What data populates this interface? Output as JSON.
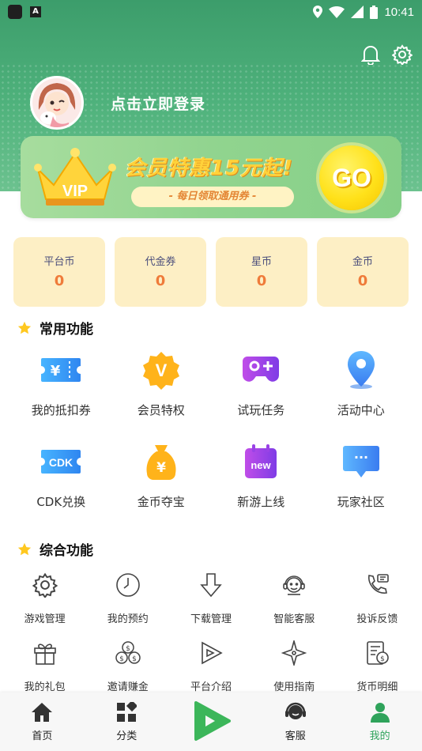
{
  "status_bar": {
    "time": "10:41",
    "app_badge": "A"
  },
  "header": {
    "login_text": "点击立即登录"
  },
  "vip_banner": {
    "vip_text": "VIP",
    "title": "会员特惠15元起!",
    "subtitle": "- 每日领取通用券 -",
    "go_label": "GO"
  },
  "currencies": [
    {
      "label": "平台币",
      "value": "0"
    },
    {
      "label": "代金券",
      "value": "0"
    },
    {
      "label": "星币",
      "value": "0"
    },
    {
      "label": "金币",
      "value": "0"
    }
  ],
  "common": {
    "title": "常用功能",
    "items": [
      {
        "label": "我的抵扣券",
        "icon": "coupon-icon",
        "glyph": "¥"
      },
      {
        "label": "会员特权",
        "icon": "vip-badge-icon",
        "glyph": "V"
      },
      {
        "label": "试玩任务",
        "icon": "gamepad-icon",
        "glyph": ""
      },
      {
        "label": "活动中心",
        "icon": "location-pin-icon",
        "glyph": ""
      },
      {
        "label": "CDK兑换",
        "icon": "cdk-icon",
        "glyph": "CDK"
      },
      {
        "label": "金币夺宝",
        "icon": "money-bag-icon",
        "glyph": "¥"
      },
      {
        "label": "新游上线",
        "icon": "new-calendar-icon",
        "glyph": "new"
      },
      {
        "label": "玩家社区",
        "icon": "chat-bubble-icon",
        "glyph": "···"
      }
    ]
  },
  "general": {
    "title": "综合功能",
    "items": [
      {
        "label": "游戏管理",
        "icon": "gear-icon"
      },
      {
        "label": "我的预约",
        "icon": "clock-icon"
      },
      {
        "label": "下载管理",
        "icon": "download-icon"
      },
      {
        "label": "智能客服",
        "icon": "service-agent-icon"
      },
      {
        "label": "投诉反馈",
        "icon": "phone-message-icon"
      },
      {
        "label": "我的礼包",
        "icon": "gift-icon"
      },
      {
        "label": "邀请赚金",
        "icon": "coins-icon"
      },
      {
        "label": "平台介绍",
        "icon": "play-triangle-icon"
      },
      {
        "label": "使用指南",
        "icon": "compass-star-icon"
      },
      {
        "label": "货币明细",
        "icon": "money-list-icon"
      }
    ]
  },
  "bottom_nav": [
    {
      "label": "首页",
      "icon": "home-icon"
    },
    {
      "label": "分类",
      "icon": "category-icon"
    },
    {
      "label": "",
      "icon": "play-center-icon"
    },
    {
      "label": "客服",
      "icon": "headset-icon"
    },
    {
      "label": "我的",
      "icon": "user-icon",
      "active": true
    }
  ],
  "colors": {
    "brand_green": "#4fb27c",
    "currency_value": "#ef7b3a",
    "card_bg": "#fdefc5",
    "nav_active": "#2fa35b"
  }
}
